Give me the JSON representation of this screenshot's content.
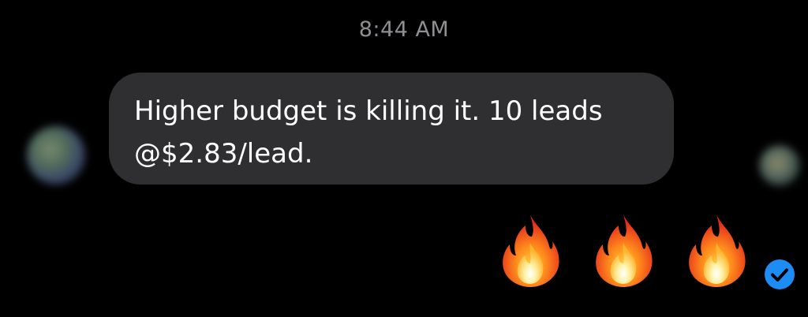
{
  "timestamp": "8:44 AM",
  "message": {
    "text": "Higher budget is killing it. 10 leads\n@$2.83/lead.",
    "bubble_color": "#2f2f31",
    "text_color": "#ffffff"
  },
  "reactions": [
    {
      "icon": "fire-icon"
    },
    {
      "icon": "fire-icon"
    },
    {
      "icon": "fire-icon"
    }
  ],
  "status": {
    "icon": "checkmark-circle-icon",
    "color": "#1d8cf5"
  },
  "colors": {
    "background": "#000000",
    "timestamp": "#8e8e93"
  }
}
